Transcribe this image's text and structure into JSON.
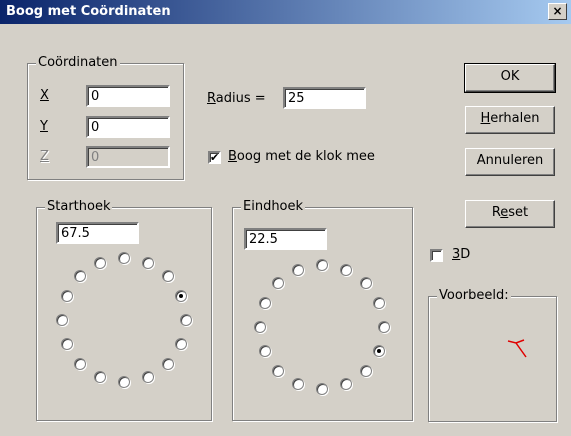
{
  "window": {
    "title": "Boog met Coördinaten",
    "close_glyph": "×"
  },
  "coords": {
    "legend": "Coördinaten",
    "x": {
      "label": "X",
      "value": "0"
    },
    "y": {
      "label": "Y",
      "value": "0"
    },
    "z": {
      "label": "Z",
      "value": "0"
    }
  },
  "radius": {
    "label": "Radius =",
    "value": "25"
  },
  "clockwise": {
    "label": "Boog met de klok mee",
    "checked": true
  },
  "starthoek": {
    "legend": "Starthoek",
    "value": "67.5",
    "selected_index": 3
  },
  "eindhoek": {
    "legend": "Eindhoek",
    "value": "22.5",
    "selected_index": 5
  },
  "buttons": {
    "ok": "OK",
    "herhalen": "Herhalen",
    "annuleren": "Annuleren",
    "reset": "Reset"
  },
  "three_d": {
    "label": "3D",
    "checked": false
  },
  "preview": {
    "legend": "Voorbeeld:",
    "arc_color": "#e00000"
  }
}
